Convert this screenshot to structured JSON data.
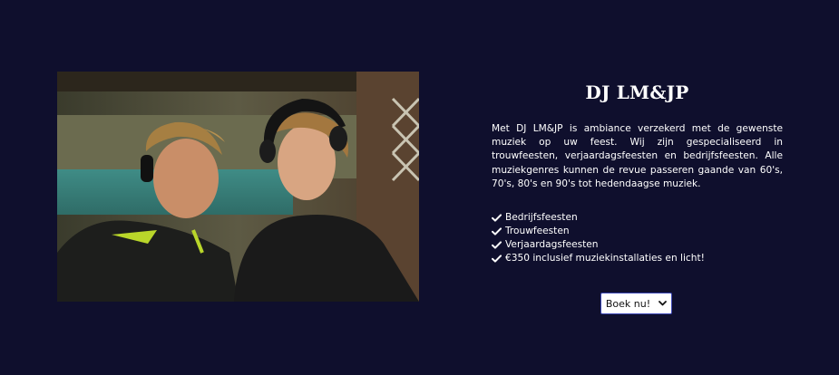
{
  "section": {
    "title": "DJ LM&JP",
    "description": "Met DJ LM&JP is ambiance verzekerd met de gewenste muziek op uw feest. Wij zijn gespecialiseerd in trouwfeesten, verjaardagsfeesten en bedrijfsfeesten. Alle muziekgenres kunnen de revue passeren gaande van 60's, 70's, 80's en 90's tot hedendaagse muziek.",
    "features": [
      {
        "label": "Bedrijfsfeesten",
        "icon": "check-icon"
      },
      {
        "label": "Trouwfeesten",
        "icon": "check-icon"
      },
      {
        "label": "Verjaardagsfeesten",
        "icon": "check-icon"
      },
      {
        "label": "€350 inclusief muziekinstallaties en licht!",
        "icon": "check-icon"
      }
    ],
    "cta": {
      "label": "Boek nu!",
      "icon": "chevron-down-icon"
    }
  },
  "colors": {
    "background": "#0f0f2d",
    "text": "#ffffff",
    "button_bg": "#ffffff",
    "button_border": "#3b46b5"
  }
}
